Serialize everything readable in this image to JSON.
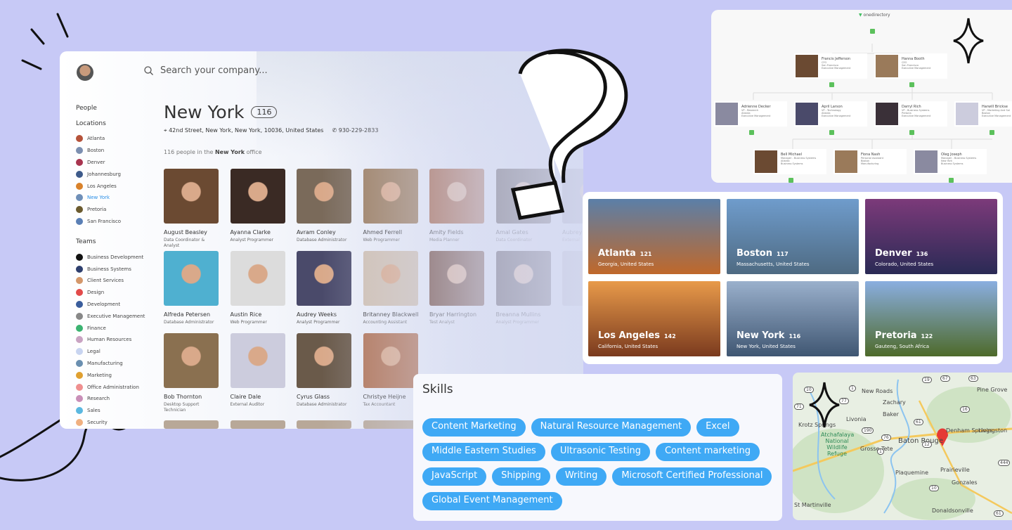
{
  "main": {
    "search_placeholder": "Search your company...",
    "sidebar": {
      "people": "People",
      "locations_title": "Locations",
      "locations": [
        {
          "label": "Atlanta",
          "color": "#b5523a"
        },
        {
          "label": "Boston",
          "color": "#7c8fb0"
        },
        {
          "label": "Denver",
          "color": "#a8344f"
        },
        {
          "label": "Johannesburg",
          "color": "#3d5a8a"
        },
        {
          "label": "Los Angeles",
          "color": "#d9822b"
        },
        {
          "label": "New York",
          "color": "#6f8fb8",
          "active": true
        },
        {
          "label": "Pretoria",
          "color": "#6b5a2e"
        },
        {
          "label": "San Francisco",
          "color": "#5a7fb5"
        }
      ],
      "teams_title": "Teams",
      "teams": [
        {
          "label": "Business Development",
          "color": "#111111"
        },
        {
          "label": "Business Systems",
          "color": "#2e3f6e"
        },
        {
          "label": "Client Services",
          "color": "#d4976a"
        },
        {
          "label": "Design",
          "color": "#e24a4a"
        },
        {
          "label": "Development",
          "color": "#3a5d9c"
        },
        {
          "label": "Executive Management",
          "color": "#888888"
        },
        {
          "label": "Finance",
          "color": "#3cb371"
        },
        {
          "label": "Human Resources",
          "color": "#c9a3c2"
        },
        {
          "label": "Legal",
          "color": "#c8d4f0"
        },
        {
          "label": "Manufacturing",
          "color": "#6a8fb0"
        },
        {
          "label": "Marketing",
          "color": "#e0a030"
        },
        {
          "label": "Office Administration",
          "color": "#ef8f8f"
        },
        {
          "label": "Research",
          "color": "#c98fb8"
        },
        {
          "label": "Sales",
          "color": "#5bb8e0"
        },
        {
          "label": "Security",
          "color": "#f0b080"
        }
      ]
    },
    "location": {
      "title": "New York",
      "count": "116",
      "address": "42nd Street, New York, New York, 10036, United States",
      "phone": "930-229-2833",
      "summary_prefix": "116 people in the ",
      "summary_bold": "New York",
      "summary_suffix": " office"
    },
    "people": [
      {
        "name": "August Beasley",
        "role": "Data Coordinator & Analyst"
      },
      {
        "name": "Ayanna Clarke",
        "role": "Analyst Programmer"
      },
      {
        "name": "Avram Conley",
        "role": "Database Administrator"
      },
      {
        "name": "Ahmed Ferrell",
        "role": "Web Programmer"
      },
      {
        "name": "Amity Fields",
        "role": "Media Planner"
      },
      {
        "name": "Amal Gates",
        "role": "Data Coordinator"
      },
      {
        "name": "Aubrey",
        "role": "External"
      },
      {
        "name": "Alfreda Petersen",
        "role": "Database Administrator"
      },
      {
        "name": "Austin Rice",
        "role": "Web Programmer"
      },
      {
        "name": "Audrey Weeks",
        "role": "Analyst Programmer"
      },
      {
        "name": "Britanney Blackwell",
        "role": "Accounting Assistant"
      },
      {
        "name": "Bryar Harrington",
        "role": "Test Analyst"
      },
      {
        "name": "Breanna Mullins",
        "role": "Analyst Programmer"
      },
      {
        "name": "",
        "role": ""
      },
      {
        "name": "Bob Thornton",
        "role": "Desktop Support Technician"
      },
      {
        "name": "Claire Dale",
        "role": "External Auditor"
      },
      {
        "name": "Cyrus Glass",
        "role": "Database Administrator"
      },
      {
        "name": "Christye Heijne",
        "role": "Tax Accountant"
      }
    ]
  },
  "org": {
    "brand": "onedirectory",
    "nodes": [
      {
        "name": "Francis Jefferson",
        "role": "CFO",
        "loc": "San Francisco",
        "team": "Executive Management",
        "count": "7"
      },
      {
        "name": "Hanna Booth",
        "role": "CEO",
        "loc": "San Francisco",
        "team": "Executive Management",
        "count": "-"
      },
      {
        "name": "Adrienne Decker",
        "role": "VP - Research",
        "loc": "Atlanta",
        "team": "Executive Management",
        "count": "22"
      },
      {
        "name": "April Larson",
        "role": "VP - Technology",
        "loc": "Atlanta",
        "team": "Executive Management",
        "count": "18"
      },
      {
        "name": "Darryl Rich",
        "role": "VP - Business Systems",
        "loc": "Pretoria",
        "team": "Executive Management",
        "count": "-"
      },
      {
        "name": "Harwill Brickse",
        "role": "VP - Marketing And Sal",
        "loc": "Boston",
        "team": "Executive Management",
        "count": "4"
      },
      {
        "name": "Bell Michael",
        "role": "Manager - Business Systems",
        "loc": "Atlanta",
        "team": "Business Systems",
        "count": "44"
      },
      {
        "name": "Fiona Nash",
        "role": "Personal Assistant",
        "loc": "Boston",
        "team": "Manufacturing",
        "count": ""
      },
      {
        "name": "Oleg Joseph",
        "role": "Manager - Business Systems",
        "loc": "New York",
        "team": "Business Systems",
        "count": "42"
      }
    ]
  },
  "cities": [
    {
      "name": "Atlanta",
      "count": "121",
      "region": "Georgia, United States",
      "colors": [
        "#5b7fa8",
        "#c0682a"
      ]
    },
    {
      "name": "Boston",
      "count": "117",
      "region": "Massachusetts, United States",
      "colors": [
        "#6f9ccc",
        "#4e6a82"
      ]
    },
    {
      "name": "Denver",
      "count": "136",
      "region": "Colorado, United States",
      "colors": [
        "#7c3a7a",
        "#2a2a55"
      ]
    },
    {
      "name": "Los Angeles",
      "count": "142",
      "region": "California, United States",
      "colors": [
        "#e89a4a",
        "#7a3a1e"
      ]
    },
    {
      "name": "New York",
      "count": "116",
      "region": "New York, United States",
      "colors": [
        "#9ab0cc",
        "#3f5672"
      ]
    },
    {
      "name": "Pretoria",
      "count": "122",
      "region": "Gauteng, South Africa",
      "colors": [
        "#8aaee0",
        "#4e6a2a"
      ]
    }
  ],
  "skills": {
    "title": "Skills",
    "items": [
      "Content Marketing",
      "Natural Resource Management",
      "Excel",
      "Middle Eastern Studies",
      "Ultrasonic Testing",
      "Content marketing",
      "JavaScript",
      "Shipping",
      "Writing",
      "Microsoft Certified Professional",
      "Global Event Management"
    ],
    "chip_color": "#3fa9f5"
  },
  "map": {
    "labels": [
      "New Roads",
      "Pine Grove",
      "Zachary",
      "Baker",
      "Livonia",
      "Krotz Springs",
      "Denham Springs",
      "Livingston",
      "Atchafalaya National Wildlife Refuge",
      "Baton Rouge",
      "Grosse Tete",
      "Prairieville",
      "Plaquemine",
      "Gonzales",
      "St Martinville",
      "Donaldsonville"
    ],
    "roads": [
      "10",
      "1",
      "19",
      "67",
      "63",
      "71",
      "77",
      "16",
      "61",
      "190",
      "76",
      "1",
      "12",
      "444",
      "10",
      "61"
    ]
  }
}
